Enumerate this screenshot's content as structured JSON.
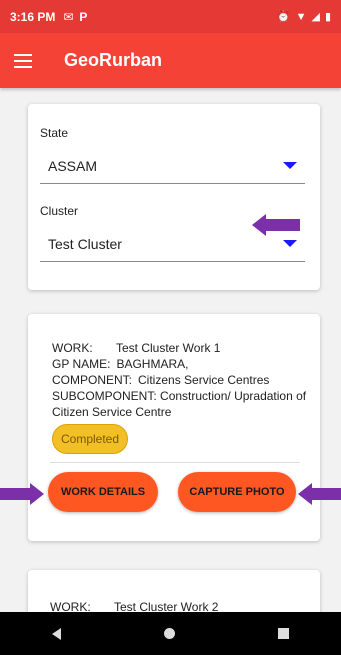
{
  "status_bar": {
    "time": "3:16 PM",
    "icons_left": [
      "gmail-icon",
      "p-app-icon"
    ],
    "icons_right": [
      "alarm-icon",
      "wifi-icon",
      "signal-icon",
      "battery-icon"
    ]
  },
  "app_bar": {
    "title": "GeoRurban"
  },
  "filters": {
    "state_label": "State",
    "state_value": "ASSAM",
    "cluster_label": "Cluster",
    "cluster_value": "Test Cluster"
  },
  "work_cards": [
    {
      "work_label": "WORK:",
      "work_value": "Test Cluster Work 1",
      "gp_label": "GP NAME:",
      "gp_value": "BAGHMARA,",
      "component_label": "COMPONENT:",
      "component_value": "Citizens Service Centres",
      "subcomponent_label": "SUBCOMPONENT:",
      "subcomponent_value": "Construction/ Upradation of Citizen Service Centre",
      "status": "Completed",
      "details_button": "WORK DETAILS",
      "photo_button": "CAPTURE PHOTO"
    },
    {
      "work_label": "WORK:",
      "work_value": "Test Cluster Work 2"
    }
  ],
  "colors": {
    "primary": "#f44336",
    "accent_button": "#ff5722",
    "badge": "#f2bf26",
    "annotation_arrow": "#7b2fa8",
    "caret": "#1a1aff"
  }
}
